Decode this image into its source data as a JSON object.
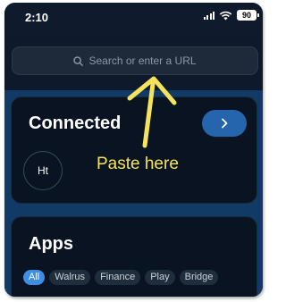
{
  "status_bar": {
    "time": "2:10",
    "battery": "90"
  },
  "search": {
    "placeholder": "Search or enter a URL"
  },
  "connected": {
    "title": "Connected",
    "avatar_initials": "Ht"
  },
  "apps": {
    "title": "Apps",
    "chips": [
      {
        "label": "All",
        "active": true
      },
      {
        "label": "Walrus"
      },
      {
        "label": "Finance"
      },
      {
        "label": "Play"
      },
      {
        "label": "Bridge"
      }
    ]
  },
  "annotation": {
    "label": "Paste here",
    "color": "#f5e35c"
  },
  "colors": {
    "accent": "#2565ad",
    "chip_active": "#3d8ee6",
    "background": "#113a66"
  }
}
